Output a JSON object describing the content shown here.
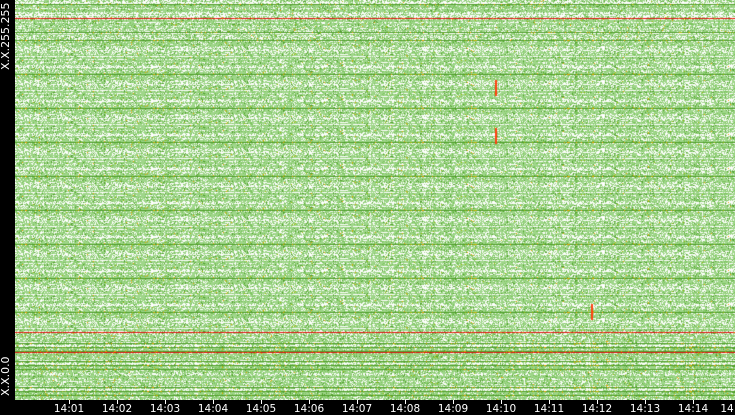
{
  "chart_data": {
    "type": "heatmap",
    "title": "",
    "xlabel": "",
    "ylabel": "",
    "x_tick_labels": [
      "14:01",
      "14:02",
      "14:03",
      "14:04",
      "14:05",
      "14:06",
      "14:07",
      "14:08",
      "14:09",
      "14:10",
      "14:11",
      "14:12",
      "14:13",
      "14:14",
      "14"
    ],
    "y_tick_labels": {
      "top": "X.X.255.255",
      "bottom": "X.X.0.0"
    },
    "y_range": [
      "X.X.0.0",
      "X.X.255.255"
    ],
    "x_range": [
      "14:00",
      "14:15"
    ],
    "color_scale": [
      "#ffffff",
      "#9fd68a",
      "#7cc45e",
      "#4f9e2a",
      "#a0b800",
      "#f0a000",
      "#ff5010",
      "#e01010"
    ],
    "notable_hot_rows_fraction_from_top": [
      0.045,
      0.83,
      0.88
    ],
    "notable_hot_spots": [
      {
        "time": "14:10",
        "ip_fraction_from_top": 0.22
      },
      {
        "time": "14:10",
        "ip_fraction_from_top": 0.34
      },
      {
        "time": "14:12",
        "ip_fraction_from_top": 0.78
      }
    ]
  }
}
